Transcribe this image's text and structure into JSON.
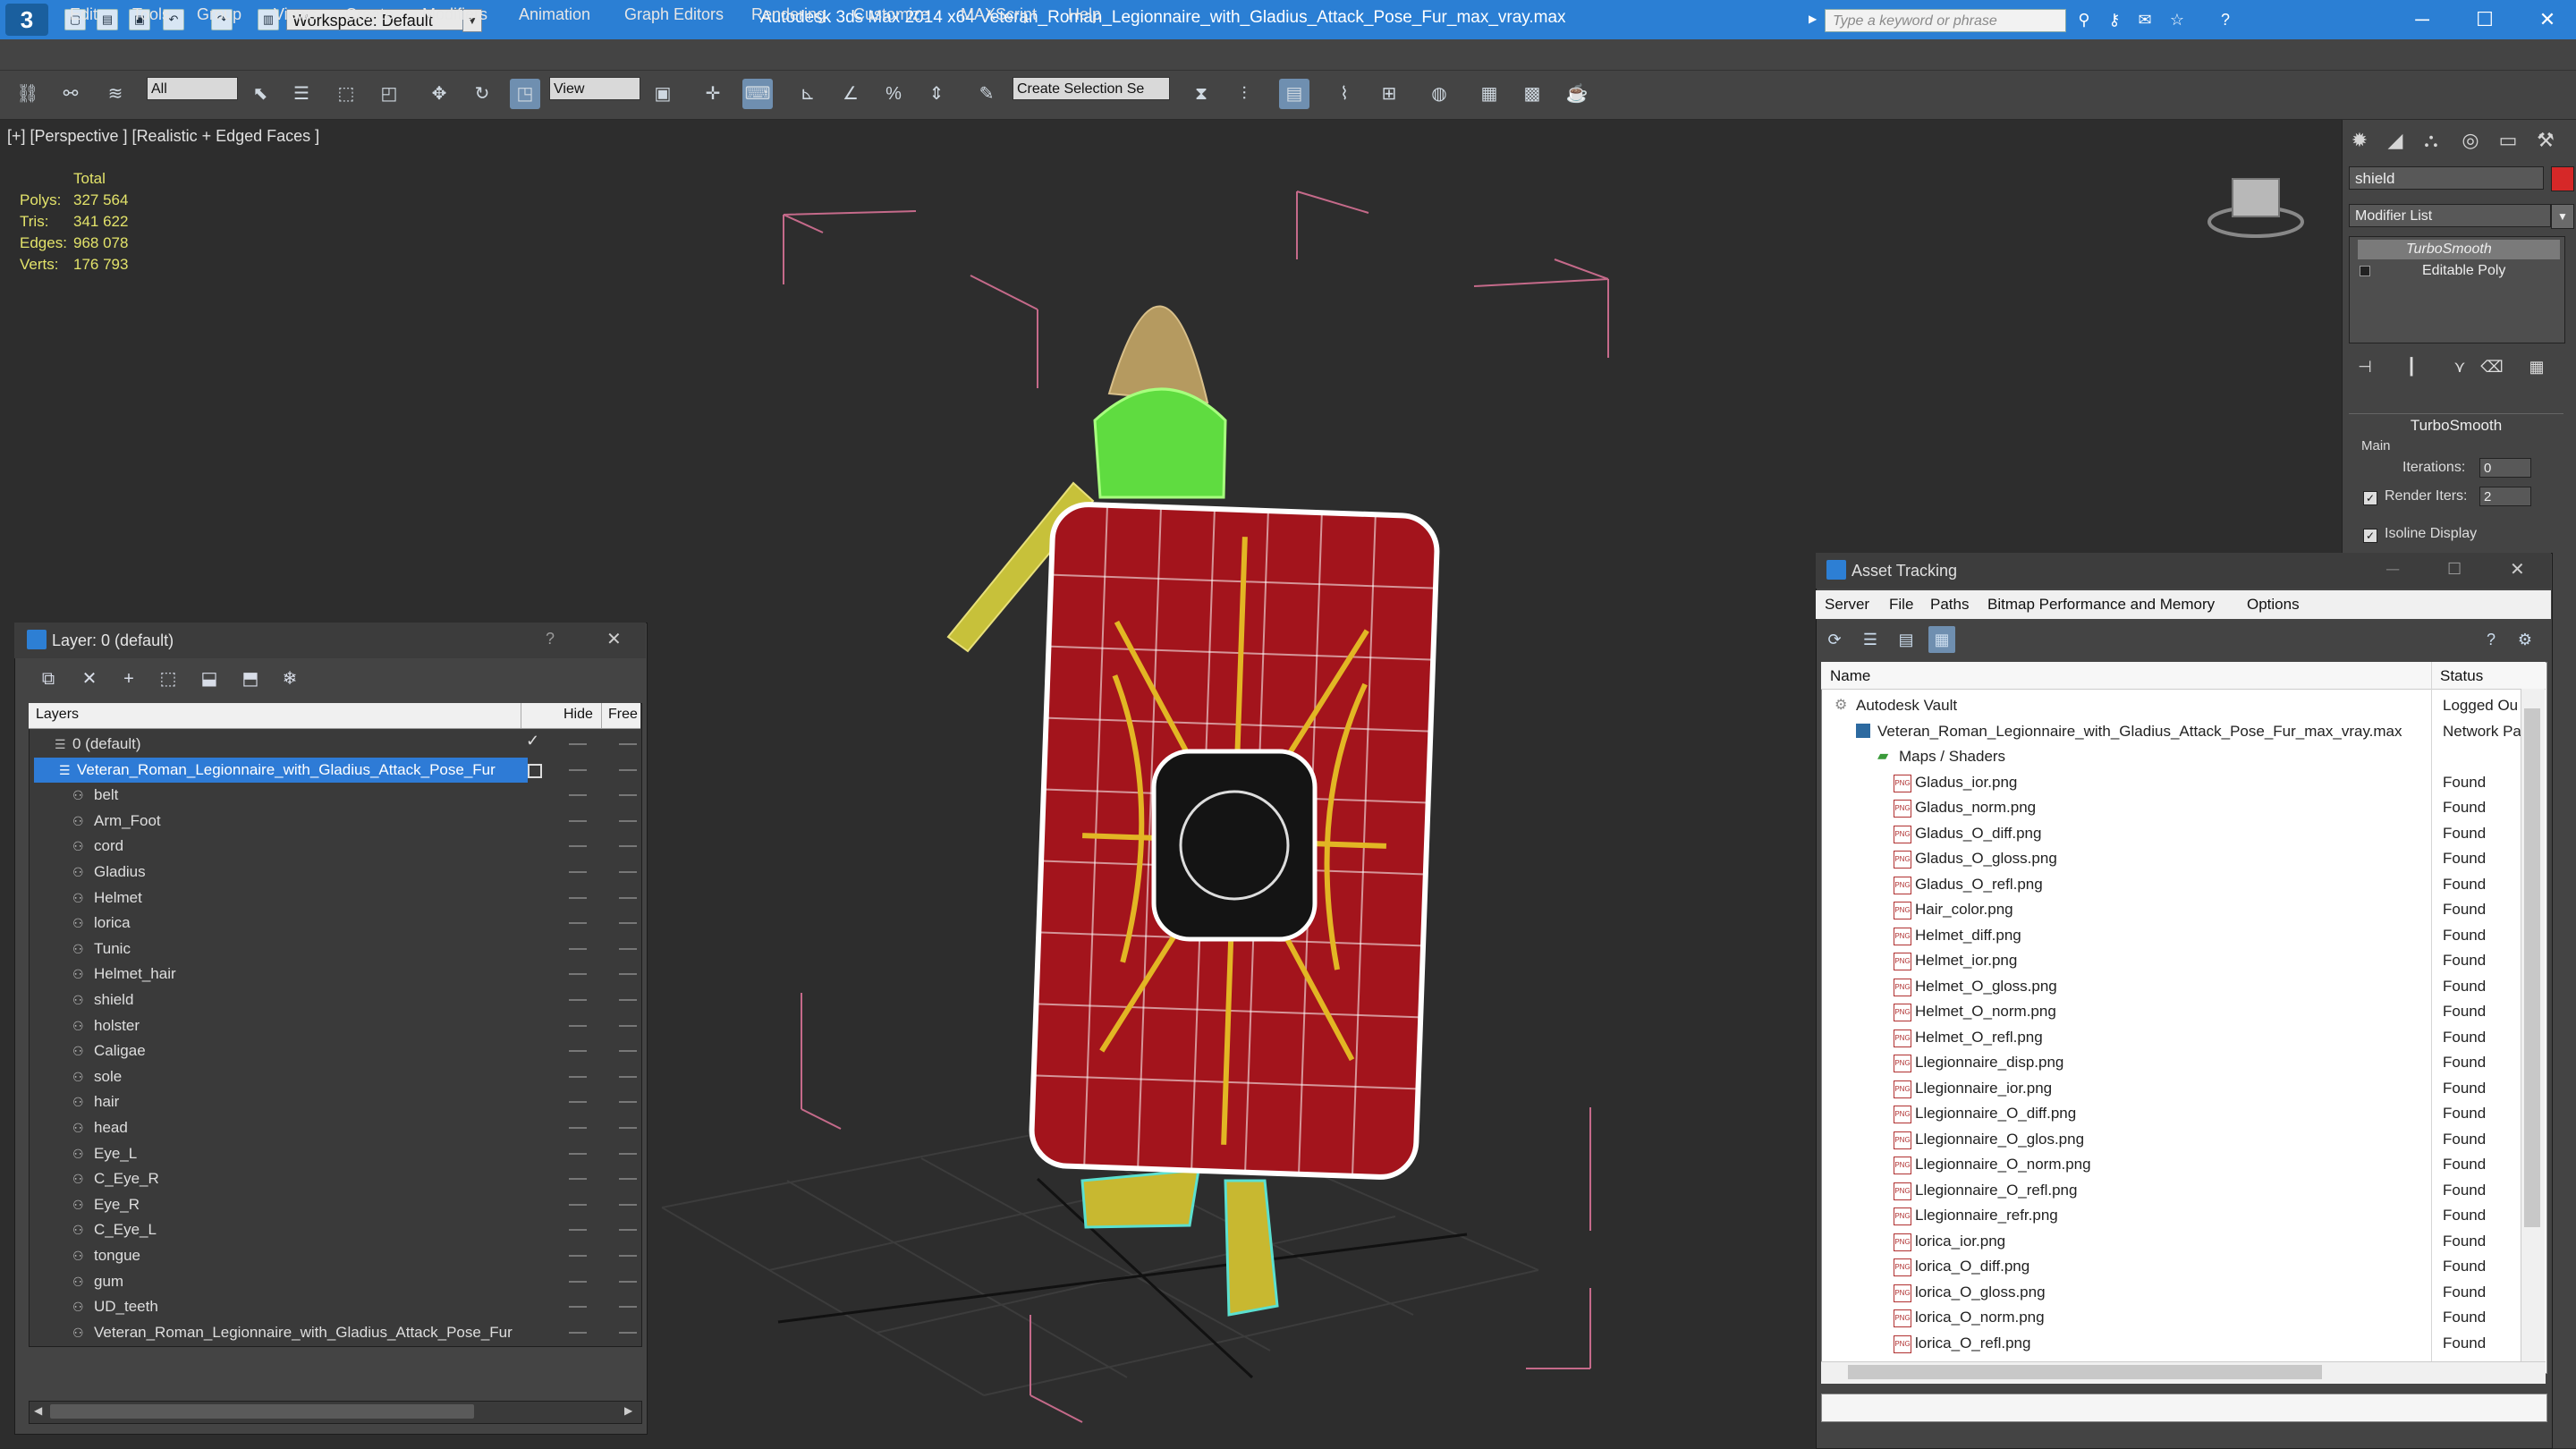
{
  "titlebar": {
    "workspace": "Workspace: Default",
    "app_title": "Autodesk 3ds Max  2014 x64     Veteran_Roman_Legionnaire_with_Gladius_Attack_Pose_Fur_max_vray.max",
    "search_placeholder": "Type a keyword or phrase"
  },
  "menu": [
    "Edit",
    "Tools",
    "Group",
    "Views",
    "Create",
    "Modifiers",
    "Animation",
    "Graph Editors",
    "Rendering",
    "Customize",
    "MAXScript",
    "Help"
  ],
  "toolbar": {
    "selection_filter": "All",
    "ref_coord": "View",
    "selection_set": "Create Selection Se"
  },
  "viewport": {
    "label": "[+] [Perspective ] [Realistic + Edged Faces ]",
    "stats": {
      "heading": "Total",
      "rows": [
        {
          "label": "Polys:",
          "value": "327 564"
        },
        {
          "label": "Tris:",
          "value": "341 622"
        },
        {
          "label": "Edges:",
          "value": "968 078"
        },
        {
          "label": "Verts:",
          "value": "176 793"
        }
      ]
    }
  },
  "command_panel": {
    "object_name": "shield",
    "object_color": "#d62828",
    "modifier_list": "Modifier List",
    "stack": [
      "TurboSmooth",
      "Editable Poly"
    ],
    "rollout_title": "TurboSmooth",
    "main_label": "Main",
    "iterations_label": "Iterations:",
    "iterations_value": "0",
    "render_iters_label": "Render Iters:",
    "render_iters_value": "2",
    "isoline_label": "Isoline Display"
  },
  "layer_dialog": {
    "title": "Layer: 0 (default)",
    "col_layers": "Layers",
    "col_hide": "Hide",
    "col_free": "Free",
    "rows": [
      {
        "name": "0 (default)",
        "indent": 1,
        "kind": "layer"
      },
      {
        "name": "Veteran_Roman_Legionnaire_with_Gladius_Attack_Pose_Fur",
        "indent": 1,
        "kind": "layer",
        "selected": true
      },
      {
        "name": "belt",
        "indent": 2
      },
      {
        "name": "Arm_Foot",
        "indent": 2
      },
      {
        "name": "cord",
        "indent": 2
      },
      {
        "name": "Gladius",
        "indent": 2
      },
      {
        "name": "Helmet",
        "indent": 2
      },
      {
        "name": "lorica",
        "indent": 2
      },
      {
        "name": "Tunic",
        "indent": 2
      },
      {
        "name": "Helmet_hair",
        "indent": 2
      },
      {
        "name": "shield",
        "indent": 2
      },
      {
        "name": "holster",
        "indent": 2
      },
      {
        "name": "Caligae",
        "indent": 2
      },
      {
        "name": "sole",
        "indent": 2
      },
      {
        "name": "hair",
        "indent": 2
      },
      {
        "name": "head",
        "indent": 2
      },
      {
        "name": "Eye_L",
        "indent": 2
      },
      {
        "name": "C_Eye_R",
        "indent": 2
      },
      {
        "name": "Eye_R",
        "indent": 2
      },
      {
        "name": "C_Eye_L",
        "indent": 2
      },
      {
        "name": "tongue",
        "indent": 2
      },
      {
        "name": "gum",
        "indent": 2
      },
      {
        "name": "UD_teeth",
        "indent": 2
      },
      {
        "name": "Veteran_Roman_Legionnaire_with_Gladius_Attack_Pose_Fur",
        "indent": 2
      }
    ]
  },
  "asset_tracking": {
    "title": "Asset Tracking",
    "menu": [
      "Server",
      "File",
      "Paths",
      "Bitmap Performance and Memory",
      "Options"
    ],
    "col_name": "Name",
    "col_status": "Status",
    "rows": [
      {
        "name": "Autodesk Vault",
        "status": "Logged Ou",
        "indent": 0,
        "kind": "vault"
      },
      {
        "name": "Veteran_Roman_Legionnaire_with_Gladius_Attack_Pose_Fur_max_vray.max",
        "status": "Network Pa",
        "indent": 1,
        "kind": "max"
      },
      {
        "name": "Maps / Shaders",
        "status": "",
        "indent": 2,
        "kind": "folder"
      },
      {
        "name": "Gladus_ior.png",
        "status": "Found",
        "indent": 3
      },
      {
        "name": "Gladus_norm.png",
        "status": "Found",
        "indent": 3
      },
      {
        "name": "Gladus_O_diff.png",
        "status": "Found",
        "indent": 3
      },
      {
        "name": "Gladus_O_gloss.png",
        "status": "Found",
        "indent": 3
      },
      {
        "name": "Gladus_O_refl.png",
        "status": "Found",
        "indent": 3
      },
      {
        "name": "Hair_color.png",
        "status": "Found",
        "indent": 3
      },
      {
        "name": "Helmet_diff.png",
        "status": "Found",
        "indent": 3
      },
      {
        "name": "Helmet_ior.png",
        "status": "Found",
        "indent": 3
      },
      {
        "name": "Helmet_O_gloss.png",
        "status": "Found",
        "indent": 3
      },
      {
        "name": "Helmet_O_norm.png",
        "status": "Found",
        "indent": 3
      },
      {
        "name": "Helmet_O_refl.png",
        "status": "Found",
        "indent": 3
      },
      {
        "name": "Llegionnaire_disp.png",
        "status": "Found",
        "indent": 3
      },
      {
        "name": "Llegionnaire_ior.png",
        "status": "Found",
        "indent": 3
      },
      {
        "name": "Llegionnaire_O_diff.png",
        "status": "Found",
        "indent": 3
      },
      {
        "name": "Llegionnaire_O_glos.png",
        "status": "Found",
        "indent": 3
      },
      {
        "name": "Llegionnaire_O_norm.png",
        "status": "Found",
        "indent": 3
      },
      {
        "name": "Llegionnaire_O_refl.png",
        "status": "Found",
        "indent": 3
      },
      {
        "name": "Llegionnaire_refr.png",
        "status": "Found",
        "indent": 3
      },
      {
        "name": "lorica_ior.png",
        "status": "Found",
        "indent": 3
      },
      {
        "name": "lorica_O_diff.png",
        "status": "Found",
        "indent": 3
      },
      {
        "name": "lorica_O_gloss.png",
        "status": "Found",
        "indent": 3
      },
      {
        "name": "lorica_O_norm.png",
        "status": "Found",
        "indent": 3
      },
      {
        "name": "lorica_O_refl.png",
        "status": "Found",
        "indent": 3
      }
    ]
  }
}
